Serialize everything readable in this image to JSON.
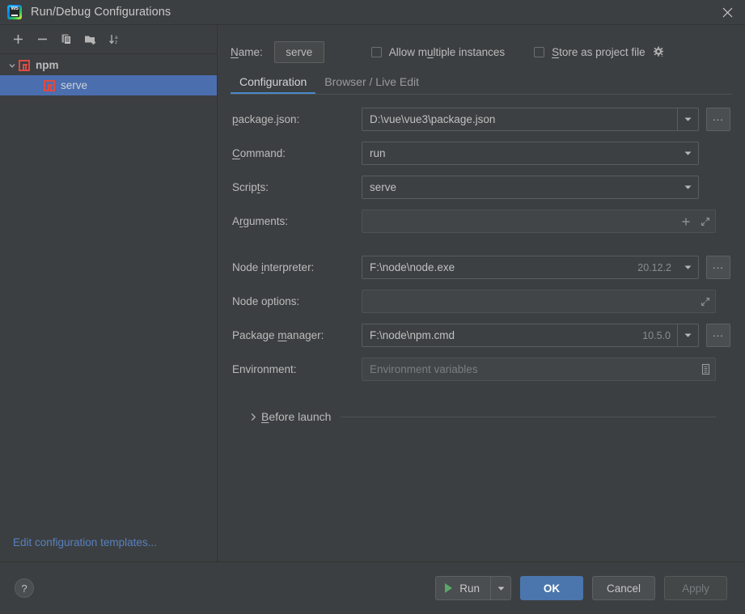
{
  "window": {
    "title": "Run/Debug Configurations",
    "app_icon": "webstorm-logo-icon",
    "close_icon": "close-icon"
  },
  "toolbar": {
    "add_label": "+",
    "remove_label": "−",
    "copy_label": "copy-configuration",
    "folder_label": "new-folder",
    "sort_label": "sort-alphabetically"
  },
  "tree": {
    "group": {
      "label": "npm",
      "expanded": true
    },
    "items": [
      {
        "label": "serve",
        "selected": true
      }
    ]
  },
  "left_footer": {
    "edit_templates": "Edit configuration templates..."
  },
  "name_row": {
    "label": "Name:",
    "value": "serve",
    "allow_multiple": {
      "label": "Allow multiple instances",
      "checked": false
    },
    "store_project_file": {
      "label": "Store as project file",
      "checked": false
    }
  },
  "tabs": [
    {
      "label": "Configuration",
      "active": true
    },
    {
      "label": "Browser / Live Edit",
      "active": false
    }
  ],
  "fields": {
    "package_json": {
      "label": "package.json:",
      "value": "D:\\vue\\vue3\\package.json"
    },
    "command": {
      "label": "Command:",
      "value": "run"
    },
    "scripts": {
      "label": "Scripts:",
      "value": "serve"
    },
    "arguments": {
      "label": "Arguments:",
      "value": ""
    },
    "node_interpreter": {
      "label": "Node interpreter:",
      "value": "F:\\node\\node.exe",
      "version": "20.12.2"
    },
    "node_options": {
      "label": "Node options:",
      "value": ""
    },
    "package_manager": {
      "label": "Package manager:",
      "value": "F:\\node\\npm.cmd",
      "version": "10.5.0"
    },
    "environment": {
      "label": "Environment:",
      "placeholder": "Environment variables",
      "value": ""
    },
    "ellipsis_label": "..."
  },
  "before_launch": {
    "label": "Before launch",
    "expanded": false
  },
  "bottom": {
    "help_label": "?",
    "run_label": "Run",
    "ok_label": "OK",
    "cancel_label": "Cancel",
    "apply_label": "Apply"
  },
  "colors": {
    "background": "#3c3f41",
    "selection": "#4b6eaf",
    "accent": "#4a88c7",
    "primary_button": "#4a76ad",
    "link": "#5781bf",
    "run_green": "#59a869",
    "npm_red": "#dd4b44"
  }
}
